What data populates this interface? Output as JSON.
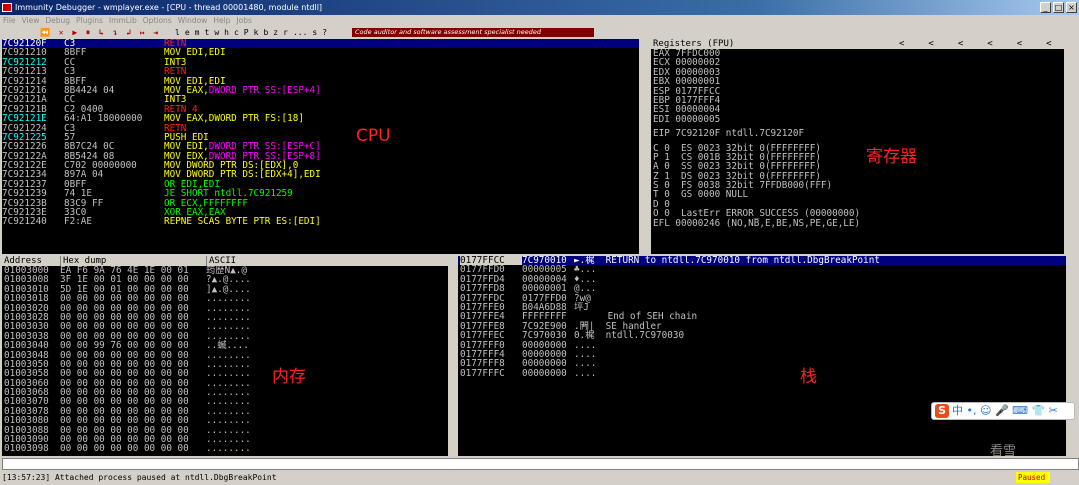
{
  "window": {
    "title": "Immunity Debugger - wmplayer.exe - [CPU - thread 00001480, module ntdll]",
    "min_label": "_",
    "max_label": "□",
    "close_label": "×"
  },
  "menu": [
    "File",
    "View",
    "Debug",
    "Plugins",
    "ImmLib",
    "Options",
    "Window",
    "Help",
    "Jobs"
  ],
  "toolbar": {
    "icons": "⏪ ✕ ▶ ⏸ ↳ ↴ ↲ ↦ ⇥",
    "letters": [
      "l",
      "e",
      "m",
      "t",
      "w",
      "h",
      "c",
      "P",
      "k",
      "b",
      "z",
      "r",
      "...",
      "s",
      "?"
    ],
    "banner": "Code auditor and software assessment specialist needed"
  },
  "cpu": {
    "rows": [
      {
        "addr": "7C92120F",
        "hex": "C3",
        "asm": "RETN",
        "color": "#ff2020",
        "selected": true
      },
      {
        "addr": "7C921210",
        "hex": "8BFF",
        "asm": "MOV EDI,EDI",
        "color": "#ffff00"
      },
      {
        "addr": "7C921212",
        "hex": "CC",
        "asm": "INT3",
        "color": "#ffff00",
        "addr_hl": true
      },
      {
        "addr": "7C921213",
        "hex": "C3",
        "asm": "RETN",
        "color": "#ff2020"
      },
      {
        "addr": "7C921214",
        "hex": "8BFF",
        "asm": "MOV EDI,EDI",
        "color": "#ffff00"
      },
      {
        "addr": "7C921216",
        "hex": "8B4424 04",
        "asm": "MOV EAX,",
        "asm2": "DWORD PTR SS:[ESP+4]",
        "color": "#ffff00"
      },
      {
        "addr": "7C92121A",
        "hex": "CC",
        "asm": "INT3",
        "color": "#ffff00"
      },
      {
        "addr": "7C92121B",
        "hex": "C2 0400",
        "asm": "RETN 4",
        "color": "#ff2020"
      },
      {
        "addr": "7C92121E",
        "hex": "64:A1 18000000",
        "asm": "MOV EAX,DWORD PTR FS:[18]",
        "color": "#ffff00",
        "addr_hl": true
      },
      {
        "addr": "7C921224",
        "hex": "C3",
        "asm": "RETN",
        "color": "#ff2020"
      },
      {
        "addr": "7C921225",
        "hex": "57",
        "asm": "PUSH EDI",
        "color": "#ffff00",
        "addr_hl": true
      },
      {
        "addr": "7C921226",
        "hex": "8B7C24 0C",
        "asm": "MOV EDI,",
        "asm2": "DWORD PTR SS:[ESP+C]",
        "color": "#ffff00"
      },
      {
        "addr": "7C92122A",
        "hex": "8B5424 08",
        "asm": "MOV EDX,",
        "asm2": "DWORD PTR SS:[ESP+8]",
        "color": "#ffff00"
      },
      {
        "addr": "7C92122E",
        "hex": "C702 00000000",
        "asm": "MOV DWORD PTR DS:[EDX],0",
        "color": "#ffff00"
      },
      {
        "addr": "7C921234",
        "hex": "897A 04",
        "asm": "MOV DWORD PTR DS:[EDX+4],EDI",
        "color": "#ffff00"
      },
      {
        "addr": "7C921237",
        "hex": "0BFF",
        "asm": "OR EDI,EDI",
        "color": "#00ff00"
      },
      {
        "addr": "7C921239",
        "hex": "74 1E",
        "asm": "JE SHORT ntdll.7C921259",
        "color": "#00ff00"
      },
      {
        "addr": "7C92123B",
        "hex": "83C9 FF",
        "asm": "OR ECX,FFFFFFFF",
        "color": "#00ff00"
      },
      {
        "addr": "7C92123E",
        "hex": "33C0",
        "asm": "XOR EAX,EAX",
        "color": "#00ff00"
      },
      {
        "addr": "7C921240",
        "hex": "F2:AE",
        "asm": "REPNE SCAS BYTE PTR ES:[EDI]",
        "color": "#ffff00"
      }
    ],
    "annotation": "CPU"
  },
  "registers": {
    "title": "Registers (FPU)",
    "nav": [
      "<",
      "<",
      "<",
      "<",
      "<",
      "<"
    ],
    "lines": [
      "EAX 7FFDC000",
      "ECX 00000002",
      "EDX 00000003",
      "EBX 00000001",
      "ESP 0177FFCC",
      "EBP 0177FFF4",
      "ESI 00000004",
      "EDI 00000005",
      "",
      "EIP 7C92120F ntdll.7C92120F",
      "",
      "C 0  ES 0023 32bit 0(FFFFFFFF)",
      "P 1  CS 001B 32bit 0(FFFFFFFF)",
      "A 0  SS 0023 32bit 0(FFFFFFFF)",
      "Z 1  DS 0023 32bit 0(FFFFFFFF)",
      "S 0  FS 0038 32bit 7FFDB000(FFF)",
      "T 0  GS 0000 NULL",
      "D 0",
      "O 0  LastErr ERROR_SUCCESS (00000000)",
      "EFL 00000246 (NO,NB,E,BE,NS,PE,GE,LE)"
    ],
    "annotation": "寄存器"
  },
  "dump": {
    "headers": [
      "Address",
      "Hex dump",
      "ASCII"
    ],
    "rows": [
      {
        "addr": "01003000",
        "hex": "EA F6 9A 76 4E 1E 00 01",
        "ascii": "筠歷N▲.@"
      },
      {
        "addr": "01003008",
        "hex": "3F 1E 00 01 00 00 00 00",
        "ascii": "?▲.@...."
      },
      {
        "addr": "01003010",
        "hex": "5D 1E 00 01 00 00 00 00",
        "ascii": "]▲.@...."
      },
      {
        "addr": "01003018",
        "hex": "00 00 00 00 00 00 00 00",
        "ascii": "........"
      },
      {
        "addr": "01003020",
        "hex": "00 00 00 00 00 00 00 00",
        "ascii": "........"
      },
      {
        "addr": "01003028",
        "hex": "00 00 00 00 00 00 00 00",
        "ascii": "........"
      },
      {
        "addr": "01003030",
        "hex": "00 00 00 00 00 00 00 00",
        "ascii": "........"
      },
      {
        "addr": "01003038",
        "hex": "00 00 00 00 00 00 00 00",
        "ascii": "........"
      },
      {
        "addr": "01003040",
        "hex": "00 00 99 76 00 00 00 00",
        "ascii": "..蝛...."
      },
      {
        "addr": "01003048",
        "hex": "00 00 00 00 00 00 00 00",
        "ascii": "........"
      },
      {
        "addr": "01003050",
        "hex": "00 00 00 00 00 00 00 00",
        "ascii": "........"
      },
      {
        "addr": "01003058",
        "hex": "00 00 00 00 00 00 00 00",
        "ascii": "........"
      },
      {
        "addr": "01003060",
        "hex": "00 00 00 00 00 00 00 00",
        "ascii": "........"
      },
      {
        "addr": "01003068",
        "hex": "00 00 00 00 00 00 00 00",
        "ascii": "........"
      },
      {
        "addr": "01003070",
        "hex": "00 00 00 00 00 00 00 00",
        "ascii": "........"
      },
      {
        "addr": "01003078",
        "hex": "00 00 00 00 00 00 00 00",
        "ascii": "........"
      },
      {
        "addr": "01003080",
        "hex": "00 00 00 00 00 00 00 00",
        "ascii": "........"
      },
      {
        "addr": "01003088",
        "hex": "00 00 00 00 00 00 00 00",
        "ascii": "........"
      },
      {
        "addr": "01003090",
        "hex": "00 00 00 00 00 00 00 00",
        "ascii": "........"
      },
      {
        "addr": "01003098",
        "hex": "00 00 00 00 00 00 00 00",
        "ascii": "........"
      }
    ],
    "annotation": "内存"
  },
  "stack": {
    "rows": [
      {
        "addr": "0177FFCC",
        "val": "7C970010",
        "comment": "►.梶  RETURN to ntdll.7C970010 from ntdll.DbgBreakPoint",
        "selected": true
      },
      {
        "addr": "0177FFD0",
        "val": "00000005",
        "comment": "♣..."
      },
      {
        "addr": "0177FFD4",
        "val": "00000004",
        "comment": "♦..."
      },
      {
        "addr": "0177FFD8",
        "val": "00000001",
        "comment": "@..."
      },
      {
        "addr": "0177FFDC",
        "val": "0177FFD0",
        "comment": "?w@"
      },
      {
        "addr": "0177FFE0",
        "val": "B04A6D88",
        "comment": "坪J"
      },
      {
        "addr": "0177FFE4",
        "val": "FFFFFFFF",
        "comment": "      End of SEH chain"
      },
      {
        "addr": "0177FFE8",
        "val": "7C92E900",
        "comment": ".闁|  SE handler"
      },
      {
        "addr": "0177FFEC",
        "val": "7C970030",
        "comment": "0.梶  ntdll.7C970030"
      },
      {
        "addr": "0177FFF0",
        "val": "00000000",
        "comment": "...."
      },
      {
        "addr": "0177FFF4",
        "val": "00000000",
        "comment": "...."
      },
      {
        "addr": "0177FFF8",
        "val": "00000000",
        "comment": "...."
      },
      {
        "addr": "0177FFFC",
        "val": "00000000",
        "comment": "...."
      }
    ],
    "annotation": "栈"
  },
  "status": {
    "text": "[13:57:23] Attached process paused at ntdll.DbgBreakPoint",
    "state": "Paused"
  },
  "ime": {
    "logo": "S",
    "text": "中 •, ☺ 🎤 ⌨ 👕 ✂"
  },
  "watermark": "看雪"
}
